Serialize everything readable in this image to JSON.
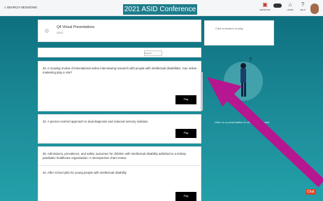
{
  "header": {
    "left_label": "≡ SEARCH SESSIONS",
    "title": "2021 ASID Conference",
    "icons": [
      {
        "name": "sessions-icon",
        "label": "SESSIONS",
        "color": "#c0392b"
      },
      {
        "name": "toggle-icon",
        "label": ""
      },
      {
        "name": "home-icon",
        "label": "HOME"
      },
      {
        "name": "help-icon",
        "label": "HELP"
      }
    ]
  },
  "presenter": {
    "title": "Q4 Virtual Presentations",
    "subtitle": "ASID"
  },
  "search": {
    "placeholder": "Search..."
  },
  "questions": [
    {
      "text": "33. A scoping review of international online interviewing research with people with intellectual disabilities. Can online marketing play a role?",
      "button": "Play"
    },
    {
      "text": "32. A person-centred approach to dual diagnosis and reduced sensory isolation",
      "button": "Play"
    },
    {
      "text": "35. Admissions, prevalence, and safety outcomes for children with intellectual disability admitted to a tertiary paediatric healthcare organisation: A retrospective chart review",
      "button": "Play"
    },
    {
      "text": "34. After school jobs for young people with intellectual disability",
      "button": "Play"
    }
  ],
  "right_panel": {
    "text": "Click a session to play"
  },
  "illustration_caption": "Click on a presentation to view it on demand",
  "chat_label": "Chat",
  "colors": {
    "accent": "#1f7d8c",
    "annotation_arrow": "#b6168f"
  }
}
